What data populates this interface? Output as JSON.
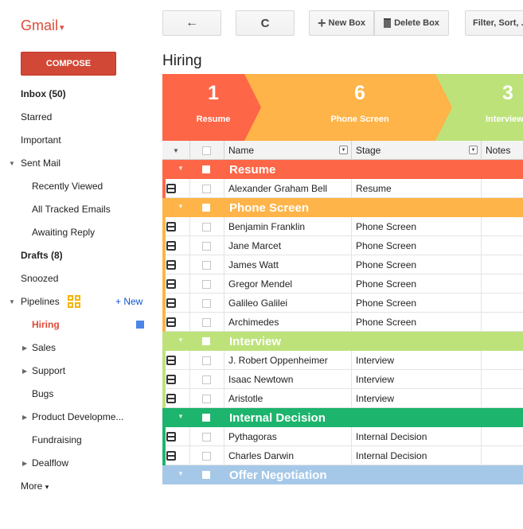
{
  "app": {
    "logo": "Gmail",
    "compose": "COMPOSE"
  },
  "nav": {
    "inbox": "Inbox (50)",
    "starred": "Starred",
    "important": "Important",
    "sent_mail": "Sent Mail",
    "recently_viewed": "Recently Viewed",
    "all_tracked": "All Tracked Emails",
    "awaiting_reply": "Awaiting Reply",
    "drafts": "Drafts (8)",
    "snoozed": "Snoozed",
    "pipelines": "Pipelines",
    "new_pipeline": "+ New",
    "hiring": "Hiring",
    "sales": "Sales",
    "support": "Support",
    "bugs": "Bugs",
    "product": "Product Developme...",
    "fundraising": "Fundraising",
    "dealflow": "Dealflow",
    "more": "More"
  },
  "toolbar": {
    "back": "←",
    "refresh": "C",
    "new_box": "New Box",
    "delete_box": "Delete Box",
    "filter": "Filter, Sort, ..."
  },
  "box_title": "Hiring",
  "stages": [
    {
      "count": "1",
      "label": "Resume",
      "color": "#fd6647"
    },
    {
      "count": "6",
      "label": "Phone Screen",
      "color": "#feb448"
    },
    {
      "count": "3",
      "label": "Interview",
      "color": "#bde27a"
    }
  ],
  "columns": {
    "name": "Name",
    "stage": "Stage",
    "notes": "Notes"
  },
  "groups": [
    {
      "name": "Resume",
      "color": "#fd6647",
      "rows": [
        {
          "name": "Alexander Graham Bell",
          "stage": "Resume"
        }
      ]
    },
    {
      "name": "Phone Screen",
      "color": "#feb448",
      "rows": [
        {
          "name": "Benjamin Franklin",
          "stage": "Phone Screen"
        },
        {
          "name": "Jane Marcet",
          "stage": "Phone Screen"
        },
        {
          "name": "James Watt",
          "stage": "Phone Screen"
        },
        {
          "name": "Gregor Mendel",
          "stage": "Phone Screen"
        },
        {
          "name": "Galileo Galilei",
          "stage": "Phone Screen"
        },
        {
          "name": "Archimedes",
          "stage": "Phone Screen"
        }
      ]
    },
    {
      "name": "Interview",
      "color": "#bde27a",
      "rows": [
        {
          "name": "J. Robert Oppenheimer",
          "stage": "Interview"
        },
        {
          "name": "Isaac Newtown",
          "stage": "Interview"
        },
        {
          "name": "Aristotle",
          "stage": "Interview"
        }
      ]
    },
    {
      "name": "Internal Decision",
      "color": "#1db46d",
      "rows": [
        {
          "name": "Pythagoras",
          "stage": "Internal Decision"
        },
        {
          "name": "Charles Darwin",
          "stage": "Internal Decision"
        }
      ]
    },
    {
      "name": "Offer Negotiation",
      "color": "#a6c8e8",
      "rows": []
    }
  ]
}
